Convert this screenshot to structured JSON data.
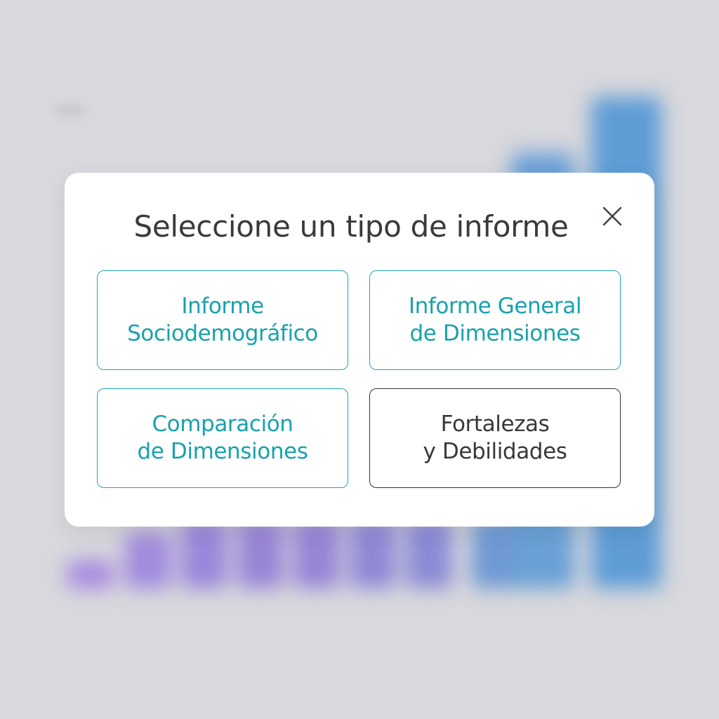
{
  "dialog": {
    "title": "Seleccione un tipo de informe",
    "close_icon": "close-icon",
    "options": [
      {
        "label": "Informe\nSociodemográfico",
        "style": "accent"
      },
      {
        "label": "Informe General\nde Dimensiones",
        "style": "accent"
      },
      {
        "label": "Comparación\nde Dimensiones",
        "style": "accent"
      },
      {
        "label": "Fortalezas\ny Debilidades",
        "style": "neutral"
      }
    ]
  },
  "colors": {
    "accent": "#17a2ad",
    "accent_border": "#21a8b4",
    "neutral_text": "#38383c",
    "backdrop": "#d8d8dd",
    "bg_bar_purple": "#9f86da",
    "bg_bar_blue": "#5d9dd6"
  }
}
